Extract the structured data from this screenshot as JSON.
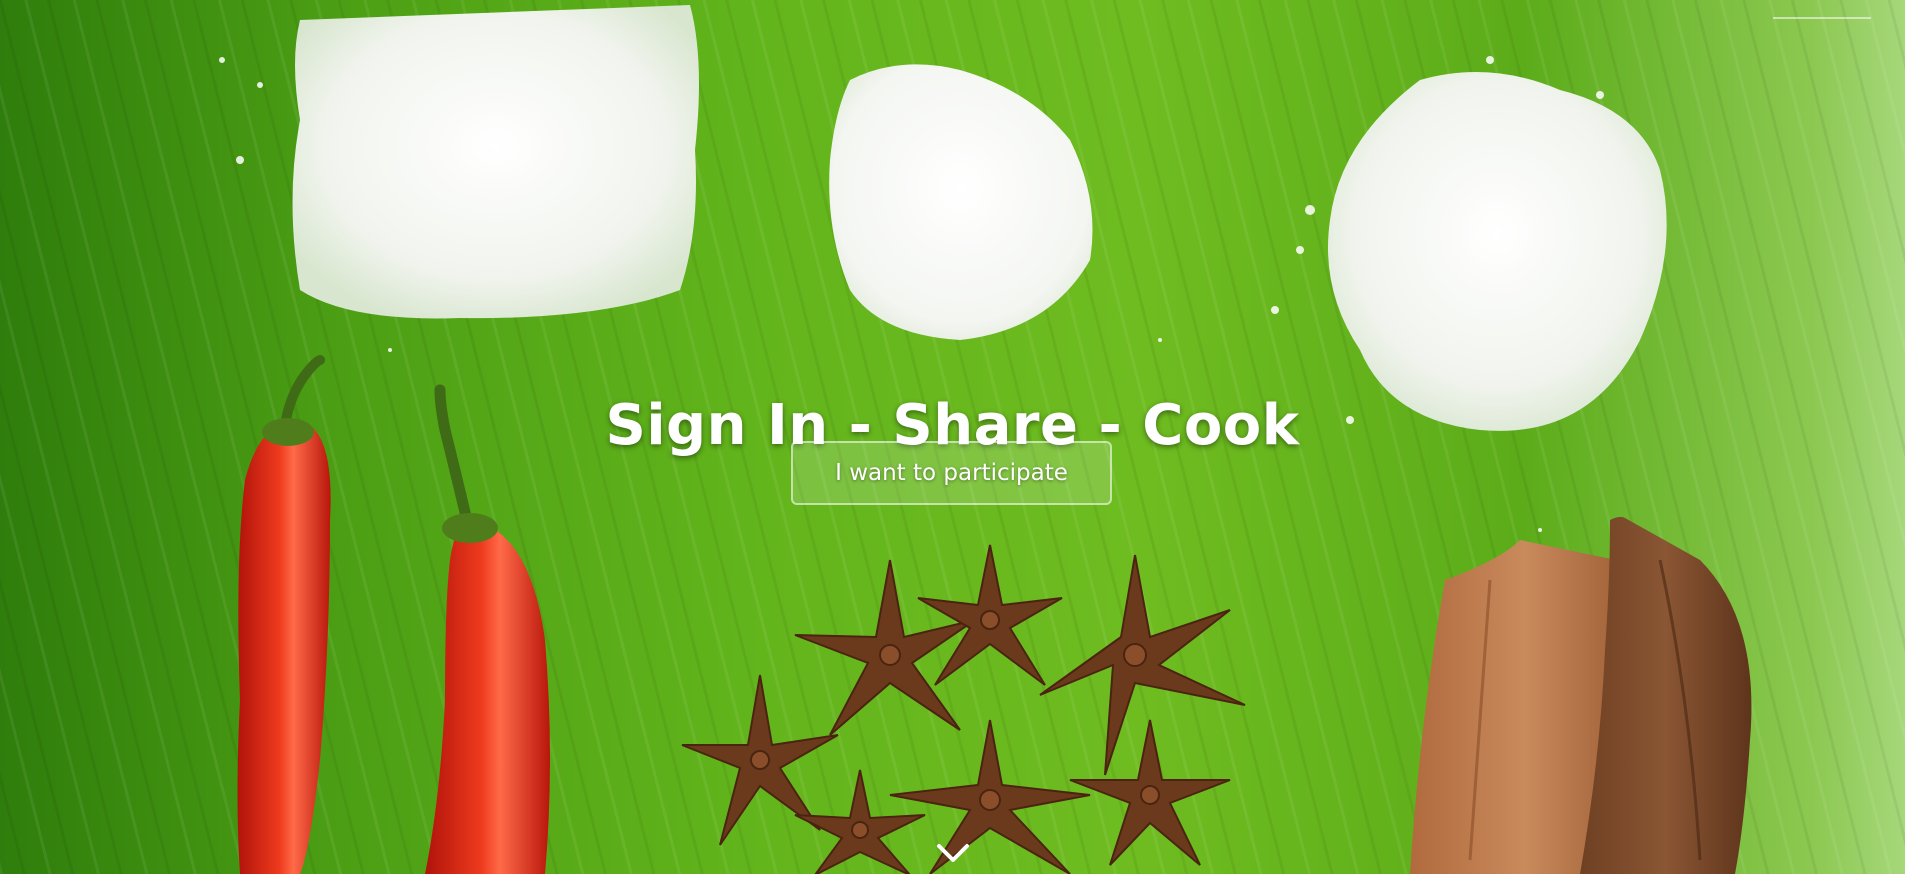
{
  "hero": {
    "headline": "Sign In - Share - Cook",
    "cta_label": "I want to participate",
    "scroll_icon": "chevron-down-icon",
    "background_image": "banana leaf with sugar, flour, salt, red chilies, star anise and cinnamon"
  },
  "colors": {
    "leaf_green": "#5cac1a",
    "chili_red": "#d81e10",
    "spice_brown": "#6b3a1c",
    "text_white": "#ffffff"
  }
}
